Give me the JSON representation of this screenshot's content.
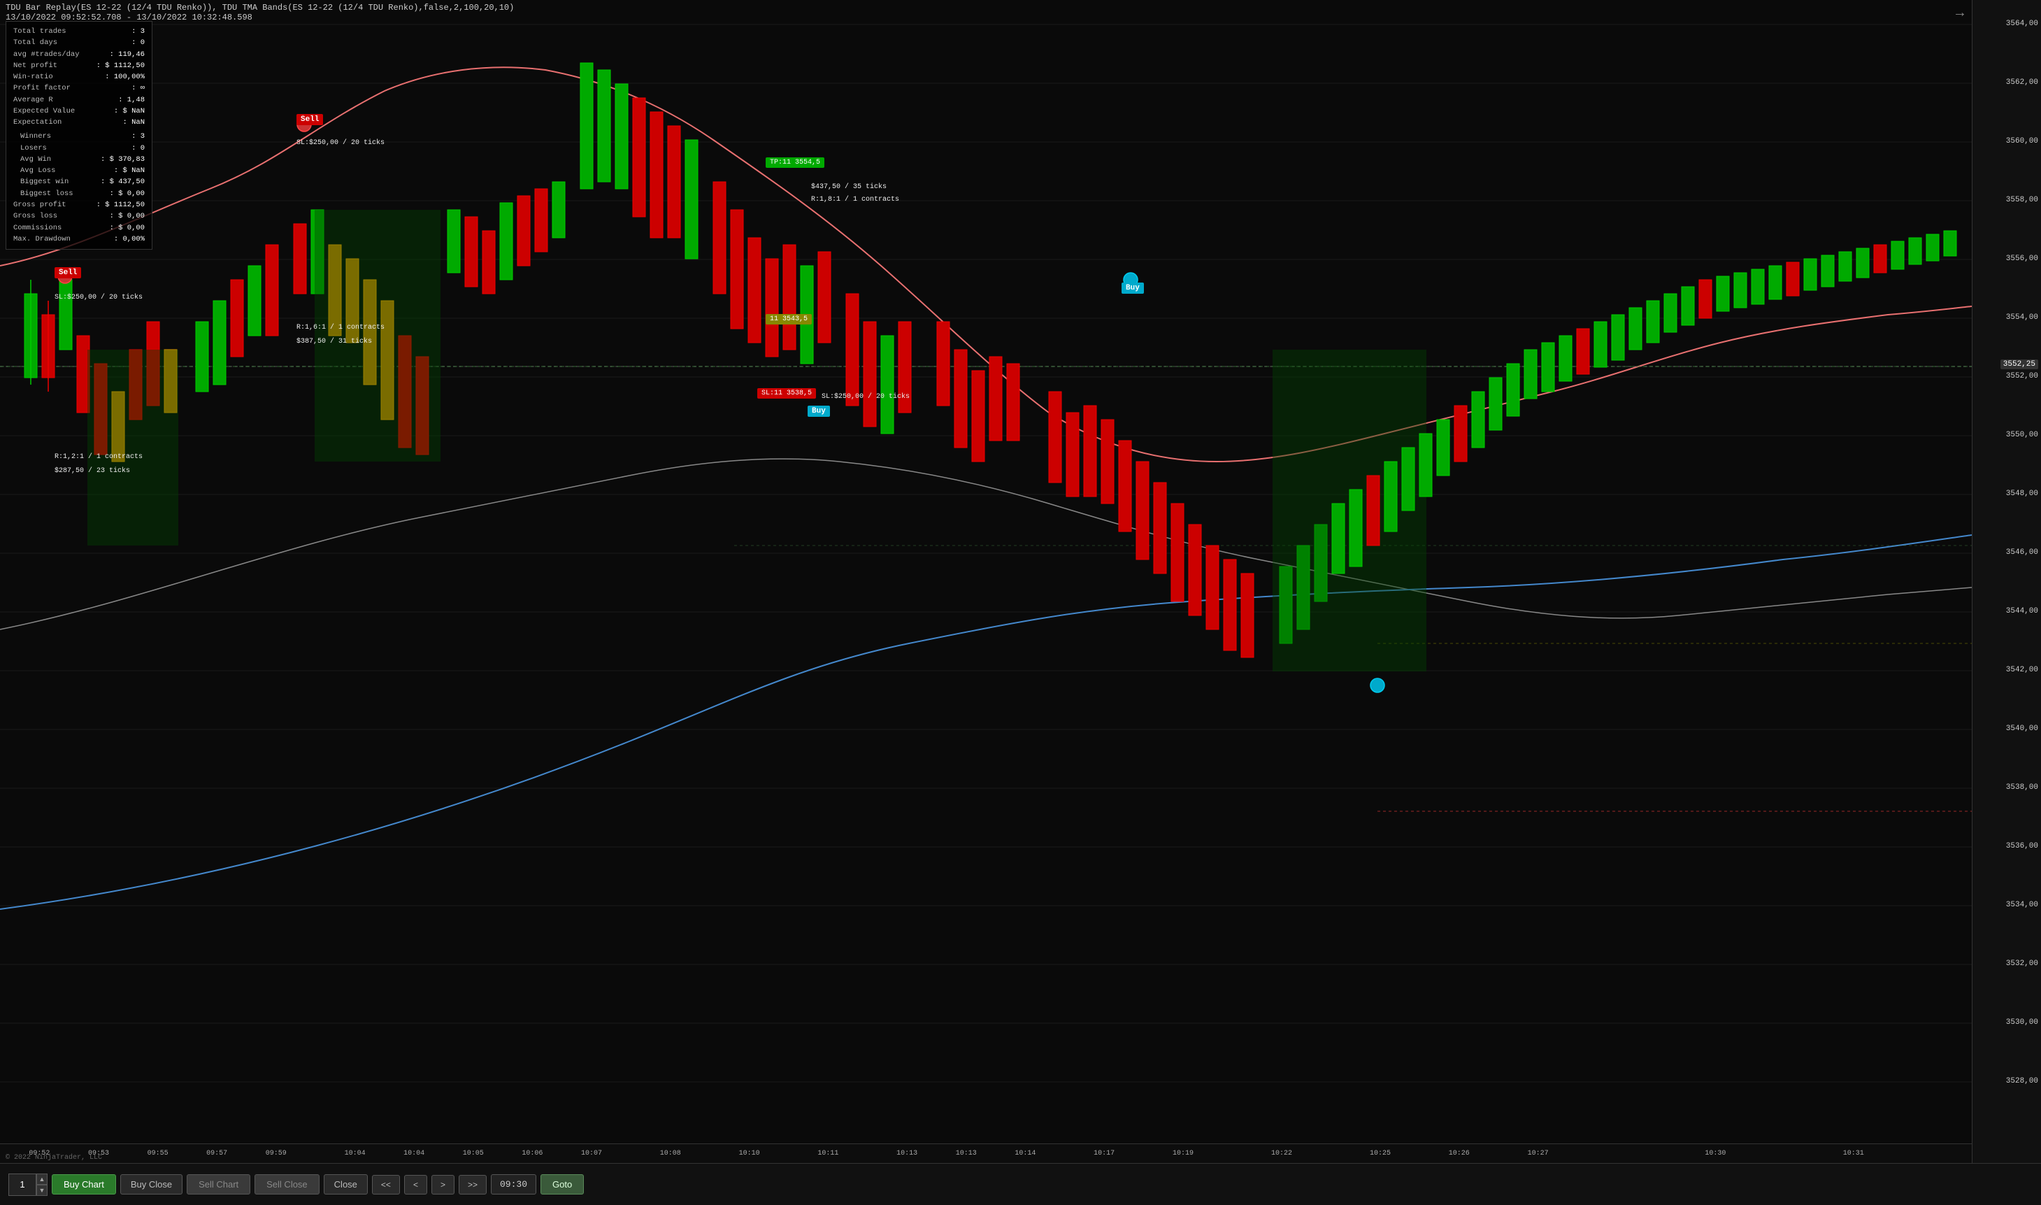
{
  "title": {
    "line1": "TDU Bar Replay(ES 12-22 (12/4 TDU Renko)), TDU TMA Bands(ES 12-22 (12/4 TDU Renko),false,2,100,20,10)",
    "line2": "13/10/2022 09:52:52.708 - 13/10/2022 10:32:48.598"
  },
  "stats": {
    "total_trades_label": "Total trades",
    "total_trades_value": ": 3",
    "total_days_label": "Total days",
    "total_days_value": ": 0",
    "avg_trades_label": "avg #trades/day",
    "avg_trades_value": ": 119,46",
    "net_profit_label": "Net profit",
    "net_profit_value": ": $ 1112,50",
    "win_ratio_label": "Win-ratio",
    "win_ratio_value": ": 100,00%",
    "profit_factor_label": "Profit factor",
    "profit_factor_value": ": ∞",
    "average_r_label": "Average R",
    "average_r_value": ": 1,48",
    "expected_value_label": "Expected Value",
    "expected_value_value": ": $ NaN",
    "expectation_label": "Expectation",
    "expectation_value": ": NaN",
    "winners_label": "Winners",
    "winners_value": ": 3",
    "losers_label": "Losers",
    "losers_value": ": 0",
    "avg_win_label": "Avg Win",
    "avg_win_value": ": $ 370,83",
    "avg_loss_label": "Avg Loss",
    "avg_loss_value": ": $ NaN",
    "biggest_win_label": "Biggest win",
    "biggest_win_value": ": $ 437,50",
    "biggest_loss_label": "Biggest loss",
    "biggest_loss_value": ": $ 0,00",
    "gross_profit_label": "Gross profit",
    "gross_profit_value": ": $ 1112,50",
    "gross_loss_label": "Gross loss",
    "gross_loss_value": ": $ 0,00",
    "commissions_label": "Commissions",
    "commissions_value": ": $ 0,00",
    "max_drawdown_label": "Max. Drawdown",
    "max_drawdown_value": ": 0,00%"
  },
  "toolbar": {
    "quantity": "1",
    "buy_chart_label": "Buy Chart",
    "buy_close_label": "Buy Close",
    "sell_chart_label": "Sell Chart",
    "sell_close_label": "Sell Close",
    "close_label": "Close",
    "prev_prev_label": "<<",
    "prev_label": "<",
    "next_label": ">",
    "next_next_label": ">>",
    "time_label": "09:30",
    "goto_label": "Goto"
  },
  "price_axis": {
    "prices": [
      {
        "value": "3564,00",
        "top_pct": 2
      },
      {
        "value": "3562,00",
        "top_pct": 7
      },
      {
        "value": "3560,00",
        "top_pct": 12
      },
      {
        "value": "3558,00",
        "top_pct": 17
      },
      {
        "value": "3556,00",
        "top_pct": 22
      },
      {
        "value": "3554,00",
        "top_pct": 27
      },
      {
        "value": "3552,25",
        "top_pct": 31,
        "highlight": true
      },
      {
        "value": "3552,00",
        "top_pct": 32
      },
      {
        "value": "3550,00",
        "top_pct": 37
      },
      {
        "value": "3548,00",
        "top_pct": 42
      },
      {
        "value": "3546,00",
        "top_pct": 47
      },
      {
        "value": "3544,00",
        "top_pct": 52
      },
      {
        "value": "3542,00",
        "top_pct": 57
      },
      {
        "value": "3540,00",
        "top_pct": 62
      },
      {
        "value": "3538,00",
        "top_pct": 67
      },
      {
        "value": "3536,00",
        "top_pct": 72
      },
      {
        "value": "3534,00",
        "top_pct": 77
      },
      {
        "value": "3532,00",
        "top_pct": 82
      },
      {
        "value": "3530,00",
        "top_pct": 87
      },
      {
        "value": "3528,00",
        "top_pct": 92
      }
    ]
  },
  "time_axis": {
    "labels": [
      {
        "label": "09:52",
        "left_pct": 2
      },
      {
        "label": "09:53",
        "left_pct": 5
      },
      {
        "label": "09:55",
        "left_pct": 8
      },
      {
        "label": "09:57",
        "left_pct": 11
      },
      {
        "label": "09:59",
        "left_pct": 14
      },
      {
        "label": "10:04",
        "left_pct": 18
      },
      {
        "label": "10:04",
        "left_pct": 21
      },
      {
        "label": "10:05",
        "left_pct": 24
      },
      {
        "label": "10:06",
        "left_pct": 27
      },
      {
        "label": "10:07",
        "left_pct": 30
      },
      {
        "label": "10:08",
        "left_pct": 34
      },
      {
        "label": "10:10",
        "left_pct": 38
      },
      {
        "label": "10:11",
        "left_pct": 42
      },
      {
        "label": "10:13",
        "left_pct": 46
      },
      {
        "label": "10:13",
        "left_pct": 49
      },
      {
        "label": "10:14",
        "left_pct": 52
      },
      {
        "label": "10:17",
        "left_pct": 56
      },
      {
        "label": "10:19",
        "left_pct": 60
      },
      {
        "label": "10:22",
        "left_pct": 65
      },
      {
        "label": "10:25",
        "left_pct": 70
      },
      {
        "label": "10:26",
        "left_pct": 74
      },
      {
        "label": "10:27",
        "left_pct": 78
      },
      {
        "label": "10:30",
        "left_pct": 87
      },
      {
        "label": "10:31",
        "left_pct": 94
      }
    ]
  },
  "trade_annotations": {
    "sell1": {
      "label": "Sell",
      "sl": "SL:$250,00 / 20 ticks",
      "r": "R:1,2:1 / 1 contracts",
      "pnl": "$287,50 / 23 ticks"
    },
    "sell2": {
      "label": "Sell",
      "sl": "SL:$250,00 / 20 ticks",
      "r": "R:1,6:1 / 1 contracts",
      "pnl": "$387,50 / 31 ticks"
    },
    "buy1": {
      "label": "Buy",
      "r": "$437,50 / 35 ticks",
      "info": "R:1,8:1 / 1 contracts"
    },
    "buy2": {
      "label": "Buy",
      "sl": "SL:$250,00 / 20 ticks"
    }
  },
  "price_labels": {
    "green_tp": "TP:11 3554,5",
    "red_sl": "SL:11 3538,5",
    "yellow_current": "11 3543,5"
  },
  "copyright": "© 2022 NinjaTrader, LLC"
}
